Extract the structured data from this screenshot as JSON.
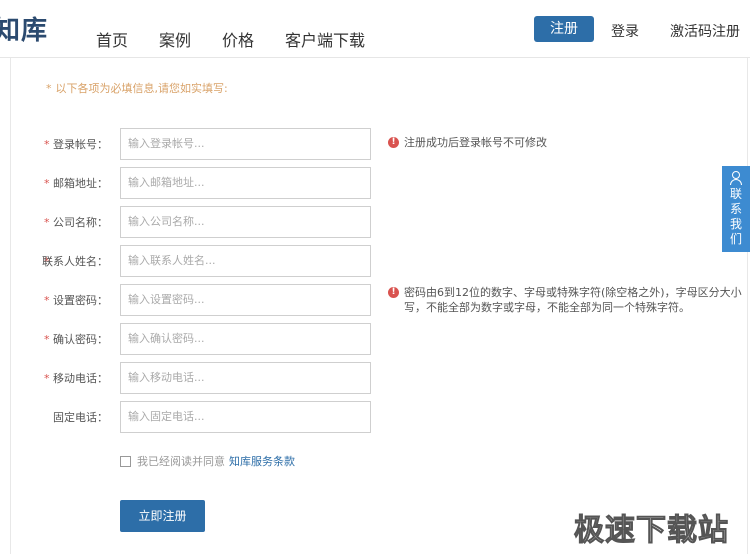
{
  "header": {
    "logo": "知库",
    "nav": [
      "首页",
      "案例",
      "价格",
      "客户端下载"
    ],
    "register_label": "注册",
    "login_label": "登录",
    "activate_label": "激活码注册"
  },
  "form": {
    "notice": "以下各项为必填信息,请您如实填写:",
    "required_mark": "*",
    "fields": [
      {
        "label": "登录帐号：",
        "placeholder": "输入登录帐号...",
        "required": true
      },
      {
        "label": "邮箱地址：",
        "placeholder": "输入邮箱地址...",
        "required": true
      },
      {
        "label": "公司名称：",
        "placeholder": "输入公司名称...",
        "required": true
      },
      {
        "label": "联系人姓名：",
        "placeholder": "输入联系人姓名...",
        "required": true
      },
      {
        "label": "设置密码：",
        "placeholder": "输入设置密码...",
        "required": true
      },
      {
        "label": "确认密码：",
        "placeholder": "输入确认密码...",
        "required": true
      },
      {
        "label": "移动电话：",
        "placeholder": "输入移动电话...",
        "required": true
      },
      {
        "label": "固定电话：",
        "placeholder": "输入固定电话...",
        "required": false
      }
    ],
    "hint_account": "注册成功后登录帐号不可修改",
    "hint_password_line1": "密码由6到12位的数字、字母或特殊字符(除空格之外)，字母区分大小",
    "hint_password_line2": "写，不能全部为数字或字母，不能全部为同一个特殊字符。",
    "agree_text": "我已经阅读并同意",
    "agree_link": "知库服务条款",
    "submit_label": "立即注册"
  },
  "side_tab": {
    "icon": "person-icon",
    "label": "联系我们"
  },
  "watermark": "极速下载站",
  "colors": {
    "primary": "#2d6ea8",
    "side_tab": "#3d8bd1",
    "notice": "#d9a36a",
    "required": "#d9534f"
  }
}
